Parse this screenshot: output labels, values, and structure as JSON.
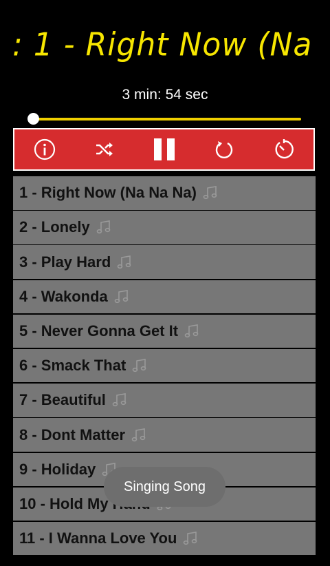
{
  "now_playing": {
    "marquee_text": ": 1 - Right Now (Na",
    "duration_text": "3 min: 54 sec",
    "progress_fraction": 0.0
  },
  "colors": {
    "title_yellow": "#f7e600",
    "toolbar_red": "#d62c2e",
    "row_gray": "#777777",
    "seek_yellow": "#f0d000"
  },
  "toolbar": {
    "buttons": [
      {
        "name": "info-button",
        "icon": "info-icon"
      },
      {
        "name": "shuffle-button",
        "icon": "shuffle-icon"
      },
      {
        "name": "pause-button",
        "icon": "pause-icon"
      },
      {
        "name": "repeat-button",
        "icon": "repeat-icon"
      },
      {
        "name": "timer-button",
        "icon": "timer-icon"
      }
    ]
  },
  "songs": [
    "1 - Right Now (Na Na Na)",
    "2 - Lonely",
    "3 - Play Hard",
    "4 - Wakonda",
    "5 - Never Gonna Get It",
    "6 - Smack That",
    "7 - Beautiful",
    "8 - Dont Matter",
    "9 - Holiday",
    "10 - Hold My Hand",
    "11 - I Wanna Love You"
  ],
  "song_icon": "music-note-icon",
  "toast": {
    "text": "Singing Song"
  }
}
